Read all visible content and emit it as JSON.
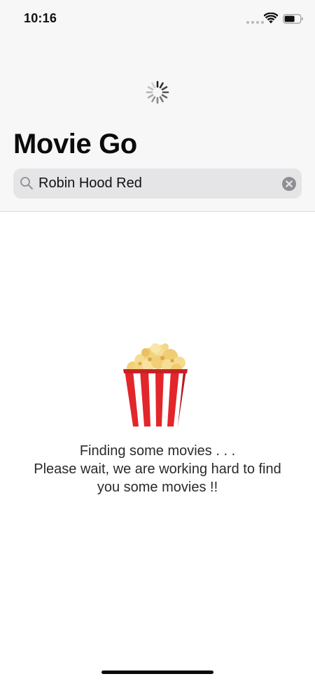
{
  "status_bar": {
    "time": "10:16"
  },
  "header": {
    "title": "Movie Go",
    "loading_indicator": "spinner-icon"
  },
  "search": {
    "value": "Robin Hood Red",
    "search_icon": "search-icon",
    "clear_icon": "clear-icon"
  },
  "empty_state": {
    "icon": "popcorn-icon",
    "line1": "Finding some movies . . .",
    "line2": "Please wait, we are working hard to find",
    "line3": "you some movies !!"
  },
  "colors": {
    "header_background": "#f7f7f7",
    "search_background": "#e5e5e8",
    "popcorn_red": "#e2262c",
    "popcorn_kernel": "#f3d27a"
  }
}
